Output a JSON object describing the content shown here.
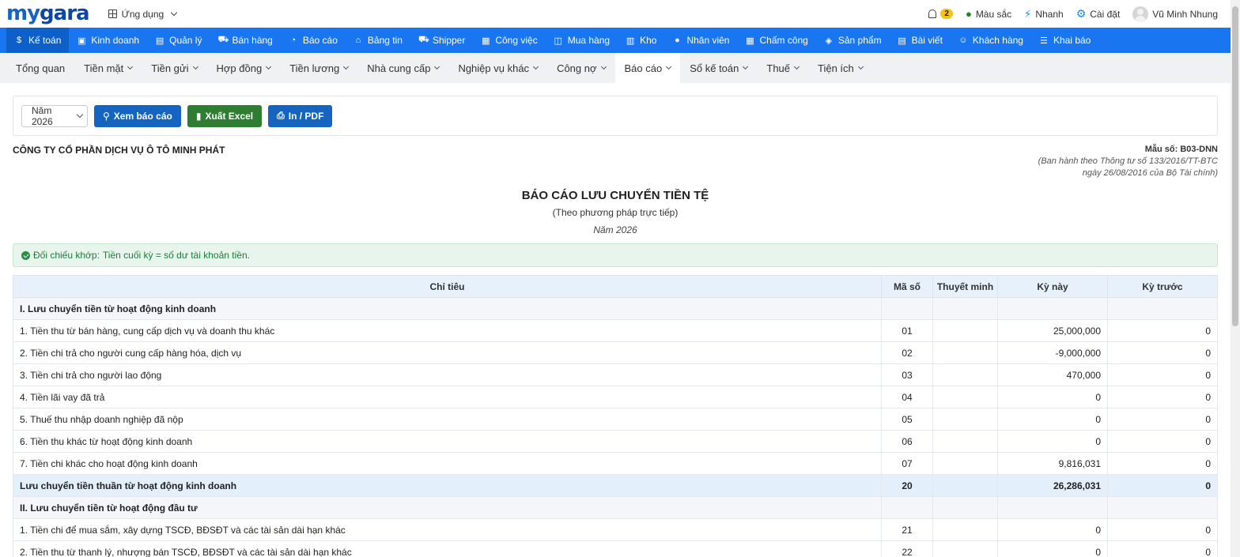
{
  "header": {
    "logo_my": "my",
    "logo_gara": "gara",
    "apps_label": "Ứng dụng",
    "notif_count": "2",
    "color_label": "Màu sắc",
    "quick_label": "Nhanh",
    "settings_label": "Cài đặt",
    "user_name": "Vũ Minh Nhung"
  },
  "modules": [
    {
      "label": "Kế toán",
      "icon": "dollar-icon"
    },
    {
      "label": "Kinh doanh",
      "icon": "bag-icon"
    },
    {
      "label": "Quản lý",
      "icon": "id-card-icon"
    },
    {
      "label": "Bán hàng",
      "icon": "cart-icon"
    },
    {
      "label": "Báo cáo",
      "icon": "pie-chart-icon"
    },
    {
      "label": "Bảng tin",
      "icon": "home-icon"
    },
    {
      "label": "Shipper",
      "icon": "truck-icon"
    },
    {
      "label": "Công việc",
      "icon": "calendar-icon"
    },
    {
      "label": "Mua hàng",
      "icon": "basket-icon"
    },
    {
      "label": "Kho",
      "icon": "warehouse-icon"
    },
    {
      "label": "Nhân viên",
      "icon": "user-icon"
    },
    {
      "label": "Chấm công",
      "icon": "calendar-check-icon"
    },
    {
      "label": "Sản phẩm",
      "icon": "box-icon"
    },
    {
      "label": "Bài viết",
      "icon": "newspaper-icon"
    },
    {
      "label": "Khách hàng",
      "icon": "smile-icon"
    },
    {
      "label": "Khai báo",
      "icon": "list-icon"
    }
  ],
  "subnav": [
    {
      "label": "Tổng quan"
    },
    {
      "label": "Tiền mặt"
    },
    {
      "label": "Tiền gửi"
    },
    {
      "label": "Hợp đồng"
    },
    {
      "label": "Tiền lương"
    },
    {
      "label": "Nhà cung cấp"
    },
    {
      "label": "Nghiệp vụ khác"
    },
    {
      "label": "Công nợ"
    },
    {
      "label": "Báo cáo"
    },
    {
      "label": "Sổ kế toán"
    },
    {
      "label": "Thuế"
    },
    {
      "label": "Tiện ích"
    }
  ],
  "toolbar": {
    "year_select": "Năm 2026",
    "view_button": "Xem báo cáo",
    "excel_button": "Xuất Excel",
    "print_button": "In / PDF"
  },
  "report": {
    "company": "CÔNG TY CỔ PHẦN DỊCH VỤ Ô TÔ MINH PHÁT",
    "form_code": "Mẫu số: B03-DNN",
    "form_note_1": "(Ban hành theo Thông tư số 133/2016/TT-BTC",
    "form_note_2": "ngày 26/08/2016 của Bộ Tài chính)",
    "title": "BÁO CÁO LƯU CHUYỂN TIỀN TỆ",
    "subtitle": "(Theo phương pháp trực tiếp)",
    "period": "Năm 2026",
    "alert_prefix": "Đối chiếu khớp:",
    "alert_text": "Tiền cuối kỳ = số dư tài khoản tiền."
  },
  "table": {
    "headers": [
      "Chỉ tiêu",
      "Mã số",
      "Thuyết minh",
      "Kỳ này",
      "Kỳ trước"
    ],
    "rows": [
      {
        "type": "section",
        "label": "I. Lưu chuyển tiền từ hoạt động kinh doanh",
        "code": "",
        "note": "",
        "current": "",
        "previous": ""
      },
      {
        "type": "item",
        "label": "1. Tiền thu từ bán hàng, cung cấp dịch vụ và doanh thu khác",
        "code": "01",
        "note": "",
        "current": "25,000,000",
        "previous": "0"
      },
      {
        "type": "item",
        "label": "2. Tiền chi trả cho người cung cấp hàng hóa, dịch vụ",
        "code": "02",
        "note": "",
        "current": "-9,000,000",
        "previous": "0",
        "negative": true
      },
      {
        "type": "item",
        "label": "3. Tiền chi trả cho người lao động",
        "code": "03",
        "note": "",
        "current": "470,000",
        "previous": "0"
      },
      {
        "type": "item",
        "label": "4. Tiền lãi vay đã trả",
        "code": "04",
        "note": "",
        "current": "0",
        "previous": "0"
      },
      {
        "type": "item",
        "label": "5. Thuế thu nhập doanh nghiệp đã nộp",
        "code": "05",
        "note": "",
        "current": "0",
        "previous": "0"
      },
      {
        "type": "item",
        "label": "6. Tiền thu khác từ hoạt động kinh doanh",
        "code": "06",
        "note": "",
        "current": "0",
        "previous": "0"
      },
      {
        "type": "item",
        "label": "7. Tiền chi khác cho hoạt động kinh doanh",
        "code": "07",
        "note": "",
        "current": "9,816,031",
        "previous": "0"
      },
      {
        "type": "subtotal",
        "label": "Lưu chuyển tiền thuần từ hoạt động kinh doanh",
        "code": "20",
        "note": "",
        "current": "26,286,031",
        "previous": "0"
      },
      {
        "type": "section",
        "label": "II. Lưu chuyển tiền từ hoạt động đầu tư",
        "code": "",
        "note": "",
        "current": "",
        "previous": ""
      },
      {
        "type": "item",
        "label": "1. Tiền chi để mua sắm, xây dựng TSCĐ, BĐSĐT và các tài sản dài hạn khác",
        "code": "21",
        "note": "",
        "current": "0",
        "previous": "0"
      },
      {
        "type": "item",
        "label": "2. Tiền thu từ thanh lý, nhượng bán TSCĐ, BĐSĐT và các tài sản dài hạn khác",
        "code": "22",
        "note": "",
        "current": "0",
        "previous": "0"
      }
    ]
  },
  "colors": {
    "brand_blue": "#1976f0",
    "active_module": "#0d5fc9",
    "negative_red": "#c62828",
    "success_green": "#2e7d32"
  }
}
